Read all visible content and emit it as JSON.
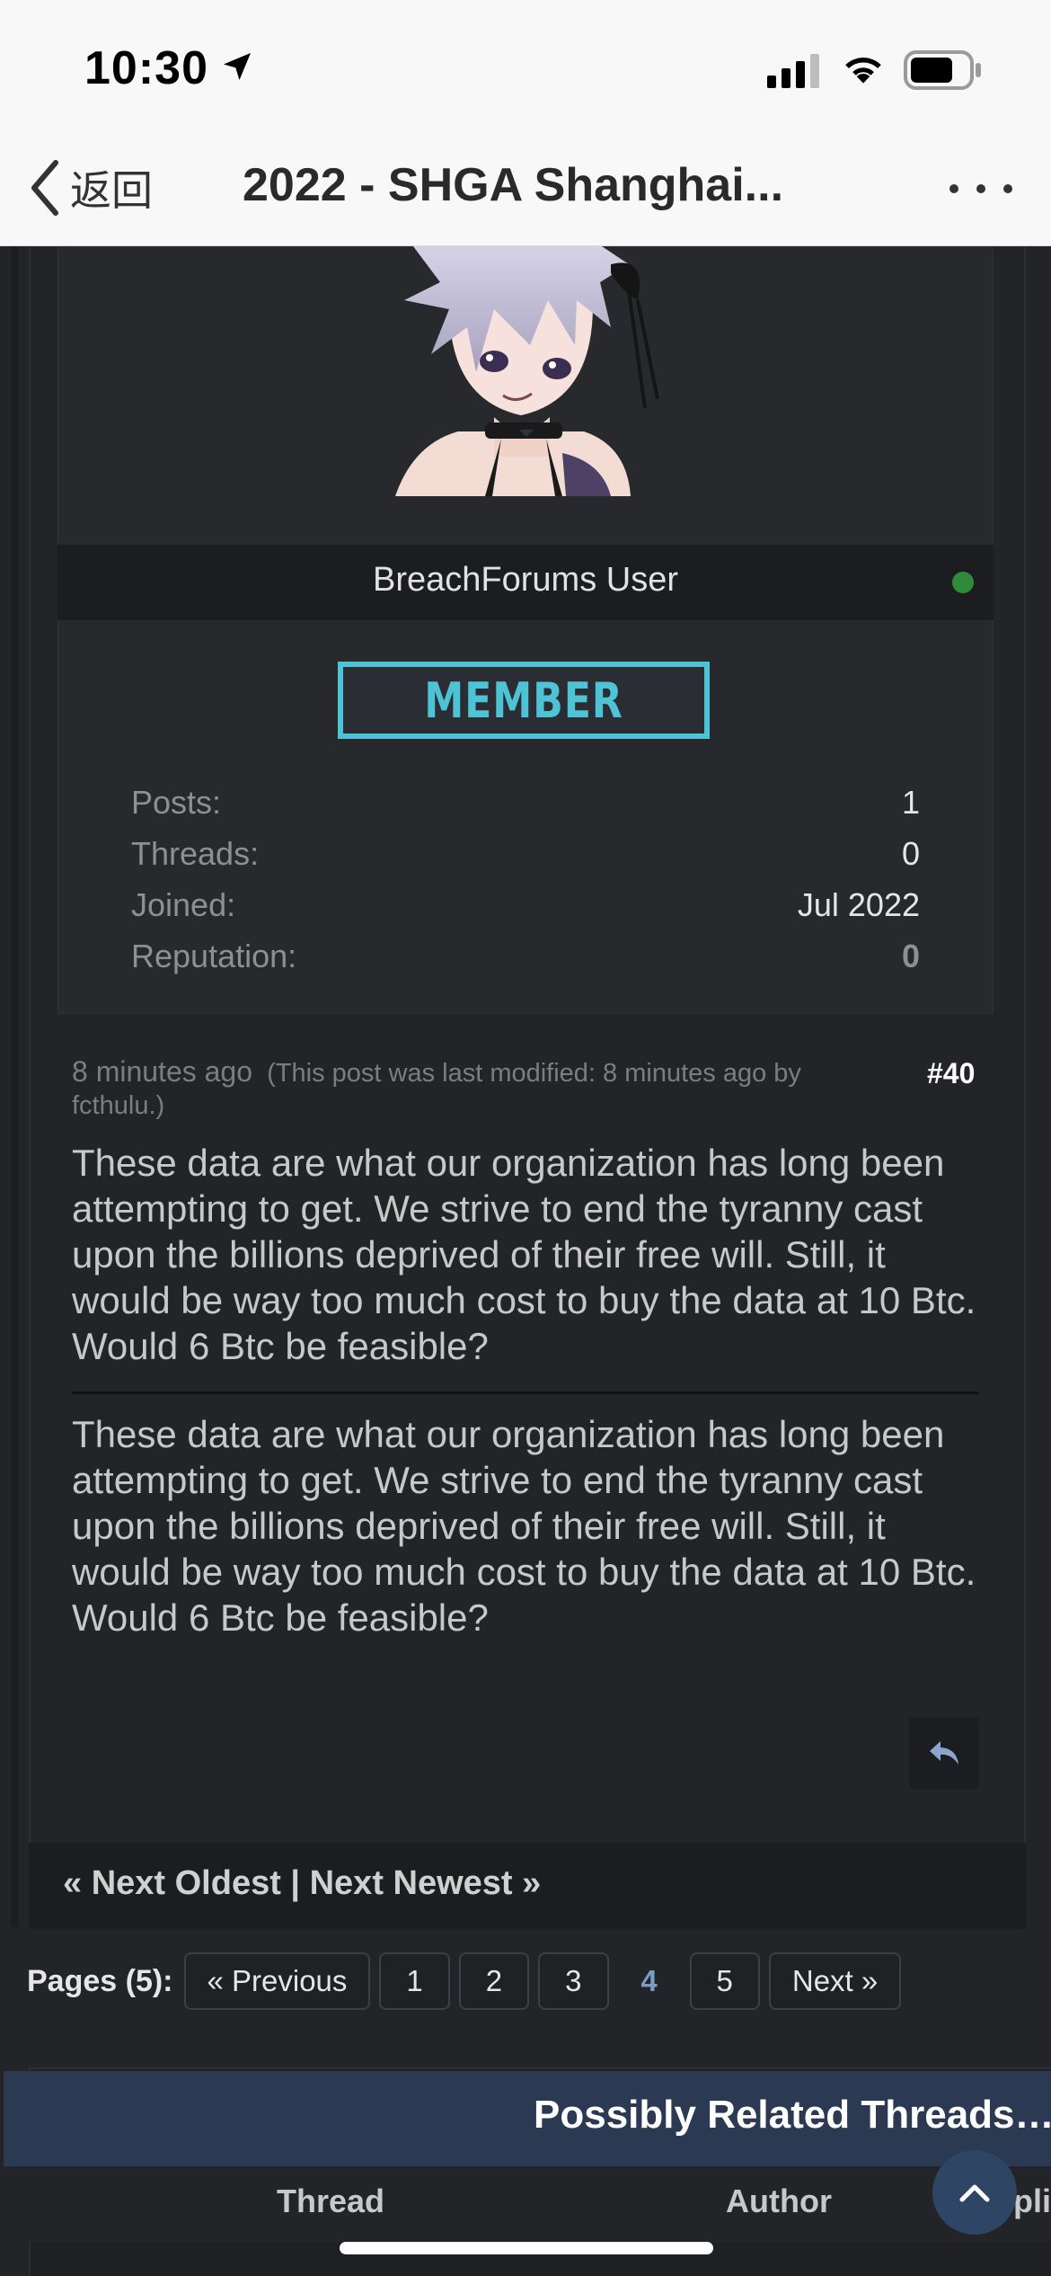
{
  "status_bar": {
    "time": "10:30",
    "icons": [
      "location-arrow-icon",
      "signal-icon",
      "wifi-icon",
      "battery-icon"
    ]
  },
  "nav": {
    "back_label": "返回",
    "title": "2022 - SHGA Shanghai...",
    "more_icon": "more-dots-icon"
  },
  "user": {
    "username": "BreachForums User",
    "online": true,
    "rank": "MEMBER",
    "stats": [
      {
        "label": "Posts:",
        "value": "1"
      },
      {
        "label": "Threads:",
        "value": "0"
      },
      {
        "label": "Joined:",
        "value": "Jul 2022"
      },
      {
        "label": "Reputation:",
        "value": "0"
      }
    ]
  },
  "post": {
    "time_ago": "8 minutes ago",
    "modified_note": "(This post was last modified: 8 minutes ago by fcthulu.)",
    "number": "#40",
    "body": "These data are what our organization has long been attempting to get. We strive to end the tyranny cast upon the billions deprived of their free will. Still, it would be way too much cost to buy the data at 10 Btc. Would 6 Btc be feasible?",
    "signature": "These data are what our organization has long been attempting to get. We strive to end the tyranny cast upon the billions deprived of their free will. Still, it would be way too much cost to buy the data at 10 Btc. Would 6 Btc be feasible?"
  },
  "thread_nav": {
    "text": "« Next Oldest | Next Newest »"
  },
  "pagination": {
    "label": "Pages (5):",
    "previous": "« Previous",
    "pages": [
      "1",
      "2",
      "3",
      "4",
      "5"
    ],
    "current": "4",
    "next": "Next »"
  },
  "related": {
    "title": "Possibly Related Threads…",
    "columns": [
      "Thread",
      "Author",
      "Replies"
    ]
  },
  "colors": {
    "background": "#232427",
    "rank_accent": "#4fc3d6",
    "online": "#2f8a3a",
    "current_page": "#7a9cc6",
    "related_header": "#2b3a52"
  }
}
